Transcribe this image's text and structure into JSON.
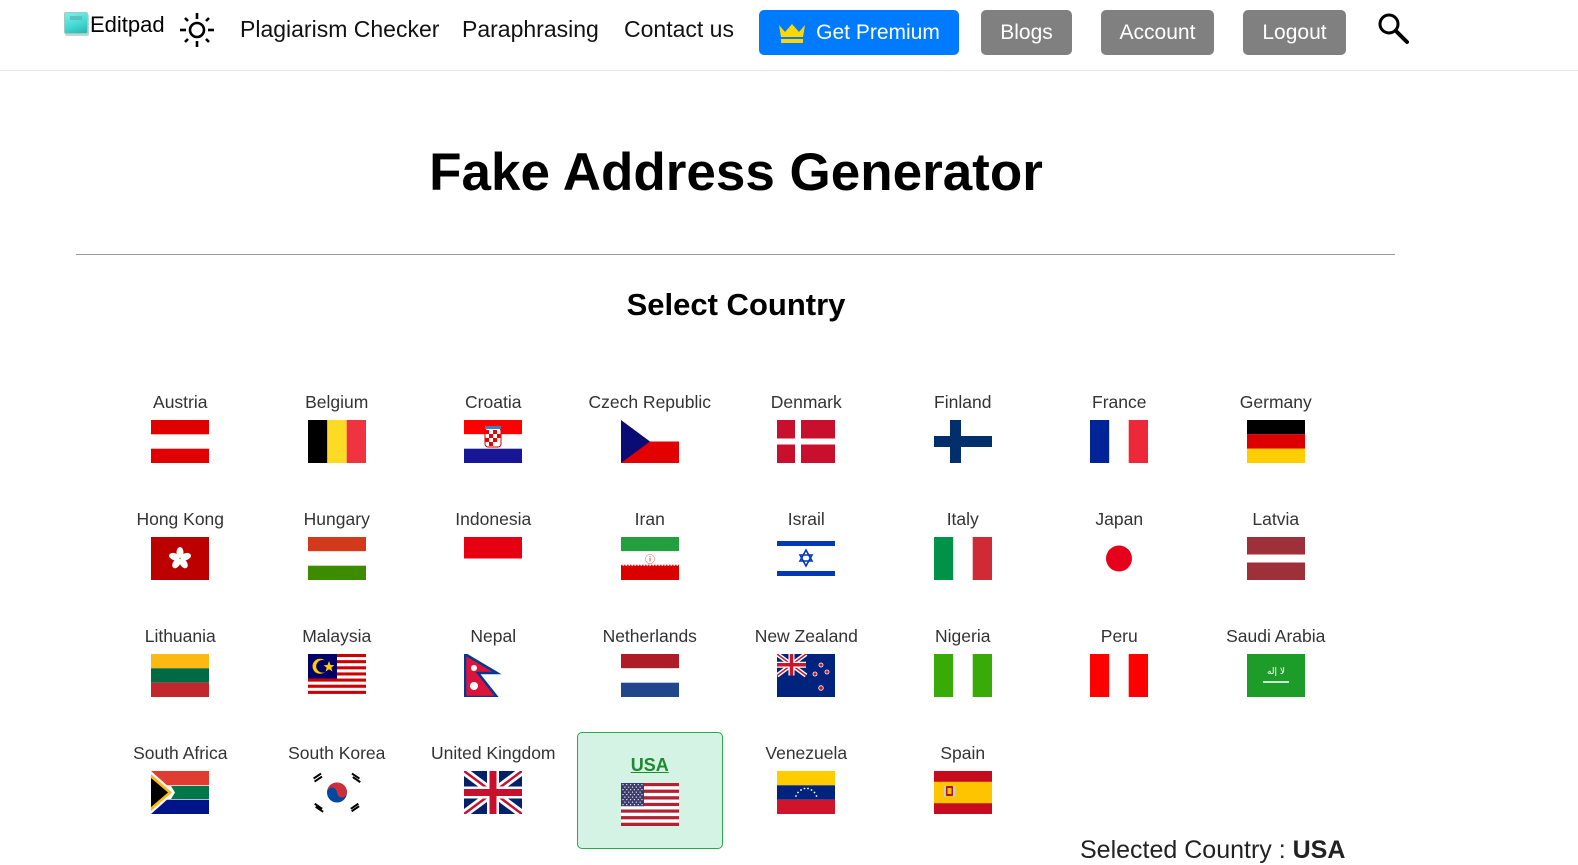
{
  "header": {
    "logo_text": "Editpad",
    "nav": [
      {
        "label": "Plagiarism Checker"
      },
      {
        "label": "Paraphrasing"
      },
      {
        "label": "Contact us"
      }
    ],
    "premium_label": "Get Premium",
    "buttons": [
      {
        "label": "Blogs"
      },
      {
        "label": "Account"
      },
      {
        "label": "Logout"
      }
    ],
    "icons": {
      "theme": "sun-icon",
      "search": "search-icon",
      "premium": "crown-icon",
      "logo": "notepad-icon"
    }
  },
  "main": {
    "title": "Fake Address Generator",
    "subtitle": "Select Country",
    "selected_prefix": "Selected Country : ",
    "selected_value": "USA",
    "countries": [
      {
        "name": "Austria",
        "flag": "austria"
      },
      {
        "name": "Belgium",
        "flag": "belgium"
      },
      {
        "name": "Croatia",
        "flag": "croatia"
      },
      {
        "name": "Czech Republic",
        "flag": "czech"
      },
      {
        "name": "Denmark",
        "flag": "denmark"
      },
      {
        "name": "Finland",
        "flag": "finland"
      },
      {
        "name": "France",
        "flag": "france"
      },
      {
        "name": "Germany",
        "flag": "germany"
      },
      {
        "name": "Hong Kong",
        "flag": "hongkong"
      },
      {
        "name": "Hungary",
        "flag": "hungary"
      },
      {
        "name": "Indonesia",
        "flag": "indonesia"
      },
      {
        "name": "Iran",
        "flag": "iran"
      },
      {
        "name": "Israil",
        "flag": "israel"
      },
      {
        "name": "Italy",
        "flag": "italy"
      },
      {
        "name": "Japan",
        "flag": "japan"
      },
      {
        "name": "Latvia",
        "flag": "latvia"
      },
      {
        "name": "Lithuania",
        "flag": "lithuania"
      },
      {
        "name": "Malaysia",
        "flag": "malaysia"
      },
      {
        "name": "Nepal",
        "flag": "nepal"
      },
      {
        "name": "Netherlands",
        "flag": "netherlands"
      },
      {
        "name": "New Zealand",
        "flag": "newzealand"
      },
      {
        "name": "Nigeria",
        "flag": "nigeria"
      },
      {
        "name": "Peru",
        "flag": "peru"
      },
      {
        "name": "Saudi Arabia",
        "flag": "saudi"
      },
      {
        "name": "South Africa",
        "flag": "southafrica"
      },
      {
        "name": "South Korea",
        "flag": "southkorea"
      },
      {
        "name": "United Kingdom",
        "flag": "uk"
      },
      {
        "name": "USA",
        "flag": "usa",
        "selected": true
      },
      {
        "name": "Venezuela",
        "flag": "venezuela"
      },
      {
        "name": "Spain",
        "flag": "spain"
      }
    ]
  },
  "colors": {
    "premium_blue": "#007bff",
    "gray_button": "#808080",
    "selected_bg": "#d4f3e4",
    "selected_border": "#2aa84a",
    "selected_text": "#1e8a2e"
  }
}
